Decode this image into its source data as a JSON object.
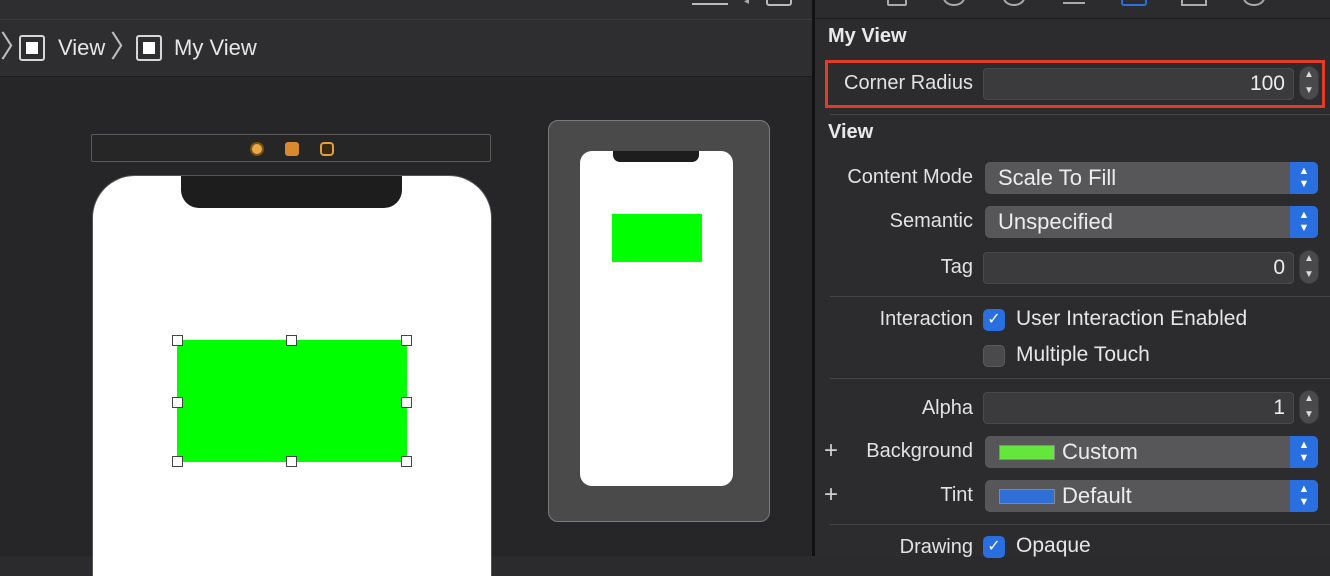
{
  "breadcrumb": {
    "items": [
      "View",
      "My View"
    ]
  },
  "canvas": {
    "preview_label": ""
  },
  "inspector": {
    "my_view": {
      "title": "My View",
      "corner_radius_label": "Corner Radius",
      "corner_radius_value": "100"
    },
    "view": {
      "title": "View",
      "content_mode_label": "Content Mode",
      "content_mode_value": "Scale To Fill",
      "semantic_label": "Semantic",
      "semantic_value": "Unspecified",
      "tag_label": "Tag",
      "tag_value": "0",
      "interaction_label": "Interaction",
      "user_interaction_label": "User Interaction Enabled",
      "user_interaction_checked": true,
      "multiple_touch_label": "Multiple Touch",
      "multiple_touch_checked": false,
      "alpha_label": "Alpha",
      "alpha_value": "1",
      "background_label": "Background",
      "background_value": "Custom",
      "background_color": "#64e63c",
      "tint_label": "Tint",
      "tint_value": "Default",
      "tint_color": "#2f6fd6",
      "drawing_label": "Drawing",
      "opaque_label": "Opaque",
      "opaque_checked": true
    }
  },
  "colors": {
    "accent": "#2a6fe0",
    "highlight": "#e23b26",
    "view_fill": "#00ff00"
  }
}
